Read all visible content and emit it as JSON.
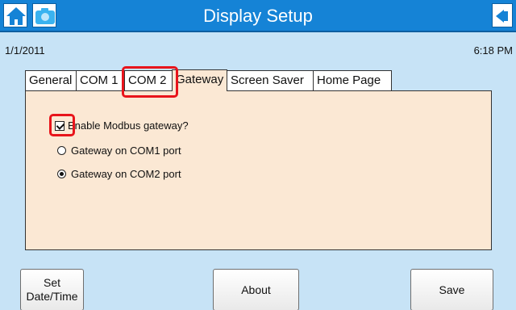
{
  "header": {
    "title": "Display Setup",
    "home_icon": "home-icon",
    "camera_icon": "camera-icon",
    "back_icon": "back-arrow-icon",
    "bar_color": "#1583d6"
  },
  "status": {
    "date": "1/1/2011",
    "time": "6:18 PM"
  },
  "tabs": [
    {
      "label": "General"
    },
    {
      "label": "COM 1"
    },
    {
      "label": "COM 2"
    },
    {
      "label": "Gateway",
      "active": true
    },
    {
      "label": "Screen Saver"
    },
    {
      "label": "Home Page"
    }
  ],
  "gateway": {
    "enable_label": "Enable Modbus gateway?",
    "enable_checked": true,
    "options": [
      {
        "label": "Gateway on COM1 port",
        "selected": false
      },
      {
        "label": "Gateway on COM2 port",
        "selected": true
      }
    ]
  },
  "buttons": {
    "set_datetime_line1": "Set",
    "set_datetime_line2": "Date/Time",
    "about": "About",
    "save": "Save"
  },
  "colors": {
    "background": "#c7e3f6",
    "panel": "#fbe8d4",
    "highlight": "#e8141b"
  }
}
